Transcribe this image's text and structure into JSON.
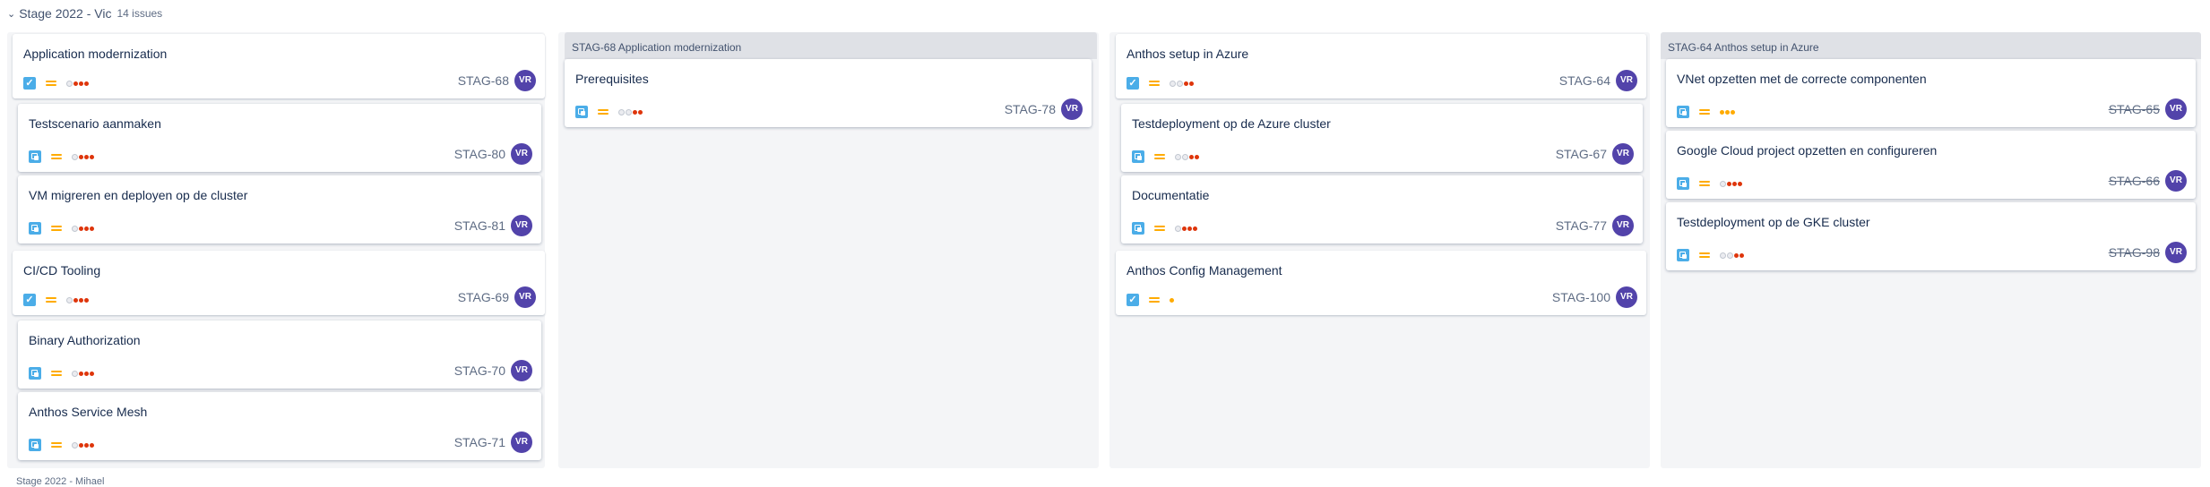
{
  "swimlane": {
    "title": "Stage 2022 - Vic",
    "count": "14 issues"
  },
  "colors": {
    "done_dot": "#de350b",
    "todo_dot": "#ebecf0",
    "partial_dot": "#ffab00",
    "avatar": "#5243aa",
    "issue_icon": "#4bade8",
    "priority": "#ffab00"
  },
  "columns": [
    {
      "cards": [
        {
          "title": "Application modernization",
          "key": "STAG-68",
          "avatar": "VR",
          "type": "task-icon",
          "dots": [
            "#ebecf0",
            "#de350b",
            "#de350b",
            "#de350b"
          ]
        },
        {
          "title": "Testscenario aanmaken",
          "key": "STAG-80",
          "avatar": "VR",
          "type": "subtask-icon",
          "dots": [
            "#ebecf0",
            "#de350b",
            "#de350b",
            "#de350b"
          ]
        },
        {
          "title": "VM migreren en deployen op de cluster",
          "key": "STAG-81",
          "avatar": "VR",
          "type": "subtask-icon",
          "dots": [
            "#ebecf0",
            "#de350b",
            "#de350b",
            "#de350b"
          ]
        },
        {
          "title": "CI/CD Tooling",
          "key": "STAG-69",
          "avatar": "VR",
          "type": "task-icon",
          "dots": [
            "#ebecf0",
            "#de350b",
            "#de350b",
            "#de350b"
          ]
        },
        {
          "title": "Binary Authorization",
          "key": "STAG-70",
          "avatar": "VR",
          "type": "subtask-icon",
          "dots": [
            "#ebecf0",
            "#de350b",
            "#de350b",
            "#de350b"
          ]
        },
        {
          "title": "Anthos Service Mesh",
          "key": "STAG-71",
          "avatar": "VR",
          "type": "subtask-icon",
          "dots": [
            "#ebecf0",
            "#de350b",
            "#de350b",
            "#de350b"
          ]
        }
      ]
    },
    {
      "parent_label": "STAG-68 Application modernization",
      "cards": [
        {
          "title": "Prerequisites",
          "key": "STAG-78",
          "avatar": "VR",
          "type": "subtask-icon",
          "dots": [
            "#ebecf0",
            "#ebecf0",
            "#de350b",
            "#de350b"
          ]
        }
      ]
    },
    {
      "cards": [
        {
          "title": "Anthos setup in Azure",
          "key": "STAG-64",
          "avatar": "VR",
          "type": "task-icon",
          "dots": [
            "#ebecf0",
            "#ebecf0",
            "#de350b",
            "#de350b"
          ]
        },
        {
          "title": "Testdeployment op de Azure cluster",
          "key": "STAG-67",
          "avatar": "VR",
          "type": "subtask-icon",
          "dots": [
            "#ebecf0",
            "#ebecf0",
            "#de350b",
            "#de350b"
          ]
        },
        {
          "title": "Documentatie",
          "key": "STAG-77",
          "avatar": "VR",
          "type": "subtask-icon",
          "dots": [
            "#ebecf0",
            "#de350b",
            "#de350b",
            "#de350b"
          ]
        },
        {
          "title": "Anthos Config Management",
          "key": "STAG-100",
          "avatar": "VR",
          "type": "task-icon",
          "dots": [
            "#ffab00"
          ]
        }
      ]
    },
    {
      "parent_label": "STAG-64 Anthos setup in Azure",
      "cards": [
        {
          "title": "VNet opzetten met de correcte componenten",
          "key": "STAG-65",
          "avatar": "VR",
          "type": "subtask-icon",
          "dots": [
            "#ffab00",
            "#ffab00",
            "#ffab00"
          ],
          "done": true
        },
        {
          "title": "Google Cloud project opzetten en configureren",
          "key": "STAG-66",
          "avatar": "VR",
          "type": "subtask-icon",
          "dots": [
            "#ebecf0",
            "#de350b",
            "#de350b",
            "#de350b"
          ],
          "done": true
        },
        {
          "title": "Testdeployment op de GKE cluster",
          "key": "STAG-98",
          "avatar": "VR",
          "type": "subtask-icon",
          "dots": [
            "#ebecf0",
            "#ebecf0",
            "#de350b",
            "#de350b"
          ],
          "done": true
        }
      ]
    }
  ],
  "next_swimlane_hint": "Stage 2022 - Mihael"
}
